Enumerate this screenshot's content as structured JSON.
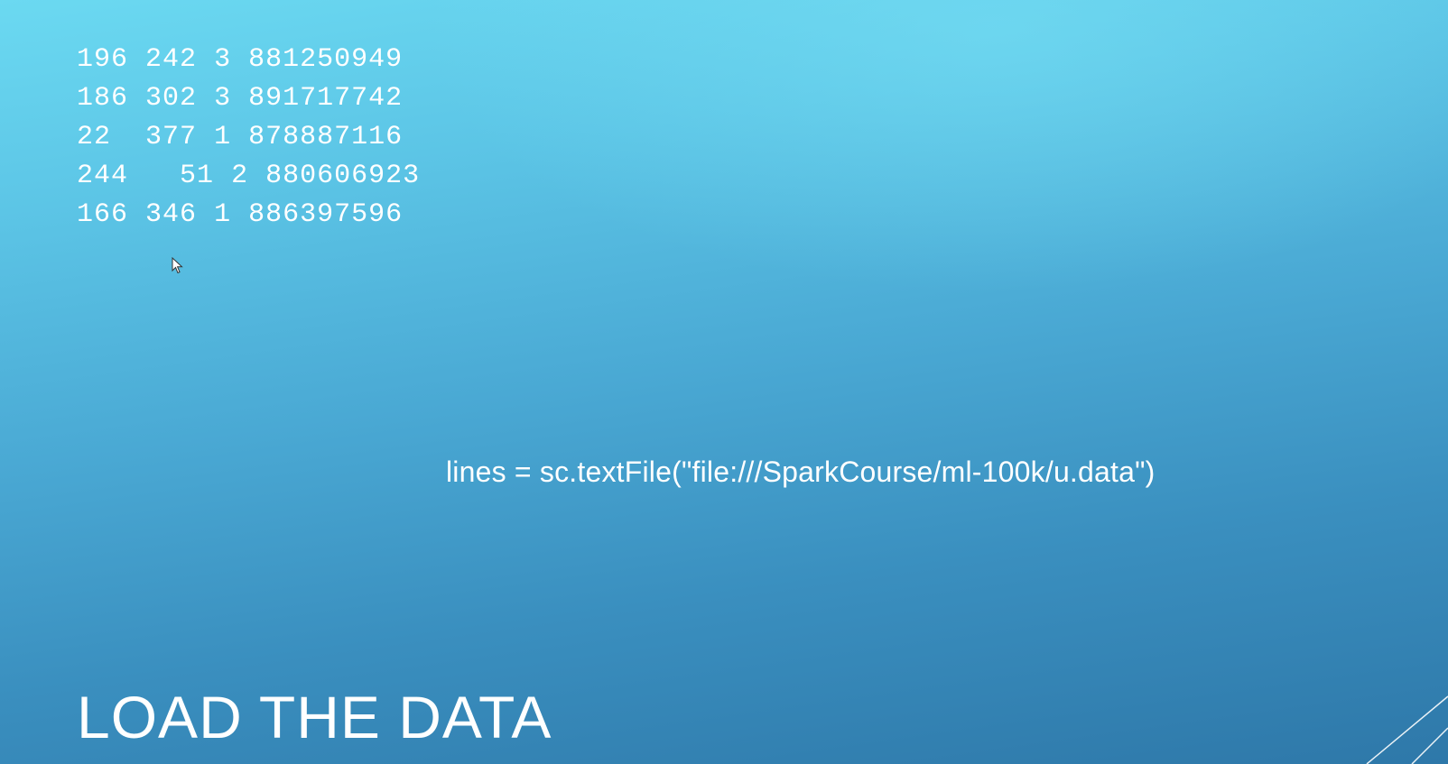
{
  "slide": {
    "title": "LOAD THE DATA",
    "code": "lines = sc.textFile(\"file:///SparkCourse/ml-100k/u.data\")",
    "data_rows": [
      [
        "196",
        "242",
        "3",
        "881250949"
      ],
      [
        "186",
        "302",
        "3",
        "891717742"
      ],
      [
        "22",
        "377",
        "1",
        "878887116"
      ],
      [
        "244",
        "51",
        "2",
        "880606923"
      ],
      [
        "166",
        "346",
        "1",
        "886397596"
      ]
    ]
  },
  "colors": {
    "text": "#ffffff",
    "background_top": "#6bd9f1",
    "background_bottom": "#2e78a9"
  },
  "icons": {
    "cursor": "mouse-pointer-icon",
    "corner": "diagonal-lines-decoration"
  }
}
